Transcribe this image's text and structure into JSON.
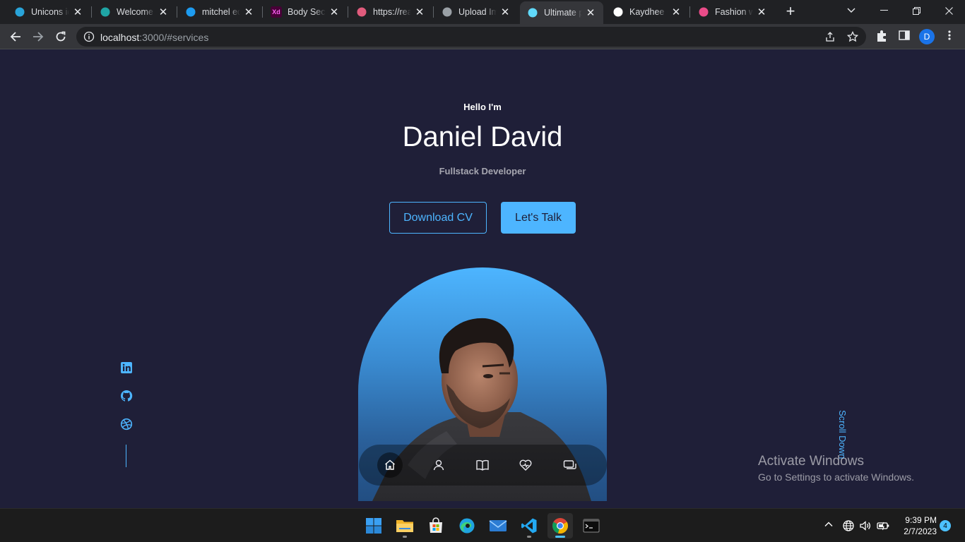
{
  "browser": {
    "tabs": [
      {
        "title": "Unicons icons",
        "favicon": "unicons-icon",
        "color": "#29a4d9"
      },
      {
        "title": "Welcome to",
        "favicon": "diamond-icon",
        "color": "#1fa5a5"
      },
      {
        "title": "mitchel edwards",
        "favicon": "twitter-icon",
        "color": "#1d9bf0"
      },
      {
        "title": "Body Secrets",
        "favicon": "xd-icon",
        "color": "#470137",
        "text": "Xd"
      },
      {
        "title": "https://react",
        "favicon": "react-icon",
        "color": "#e05b7c"
      },
      {
        "title": "Upload Images",
        "favicon": "layers-icon",
        "color": "#9aa0a6"
      },
      {
        "title": "Ultimate portfolio",
        "favicon": "react-icon",
        "color": "#61dafb"
      },
      {
        "title": "Kaydhee (Kaydhee)",
        "favicon": "github-icon",
        "color": "#ffffff"
      },
      {
        "title": "Fashion website",
        "favicon": "dribbble-icon",
        "color": "#ea4c89"
      }
    ],
    "active_tab": 6,
    "address": {
      "host": "localhost",
      "rest": ":3000/#services"
    },
    "profile_initial": "D"
  },
  "hero": {
    "greeting": "Hello I'm",
    "name": "Daniel David",
    "role": "Fullstack Developer",
    "download_cv": "Download CV",
    "lets_talk": "Let's Talk",
    "scroll_down": "Scroll Down"
  },
  "socials": [
    "linkedin-icon",
    "github-icon",
    "dribbble-icon"
  ],
  "dock": [
    "home-icon",
    "user-icon",
    "book-icon",
    "services-icon",
    "message-icon"
  ],
  "watermark": {
    "title": "Activate Windows",
    "subtitle": "Go to Settings to activate Windows."
  },
  "taskbar": {
    "apps": [
      "windows-start-icon",
      "file-explorer-icon",
      "microsoft-store-icon",
      "edge-icon",
      "mail-icon",
      "vscode-icon",
      "chrome-icon",
      "terminal-icon"
    ],
    "time": "9:39 PM",
    "date": "2/7/2023",
    "notifications": "4"
  },
  "colors": {
    "accent": "#4db5ff",
    "background": "#1f1f38"
  }
}
